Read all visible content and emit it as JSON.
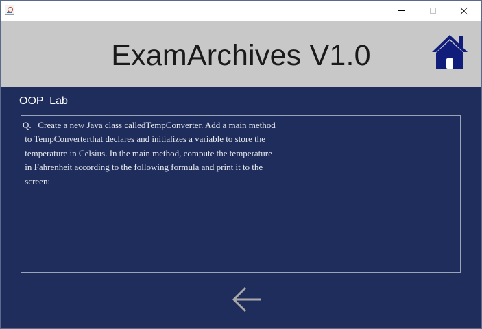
{
  "window": {
    "controls": [
      "minimize",
      "maximize",
      "close"
    ]
  },
  "header": {
    "title": "ExamArchives V1.0",
    "home_icon": "home-icon"
  },
  "content": {
    "subject": "OOP  Lab",
    "question": "Q.   Create a new Java class calledTempConverter. Add a main method\n to TempConverterthat declares and initializes a variable to store the\n temperature in Celsius. In the main method, compute the temperature\n in Fahrenheit according to the following formula and print it to the\n screen:"
  },
  "nav": {
    "back_icon": "arrow-left-icon"
  },
  "colors": {
    "background": "#1f2d5c",
    "header": "#c8c8c8",
    "home_icon": "#101d7a",
    "back_arrow": "#a9a9a9"
  }
}
